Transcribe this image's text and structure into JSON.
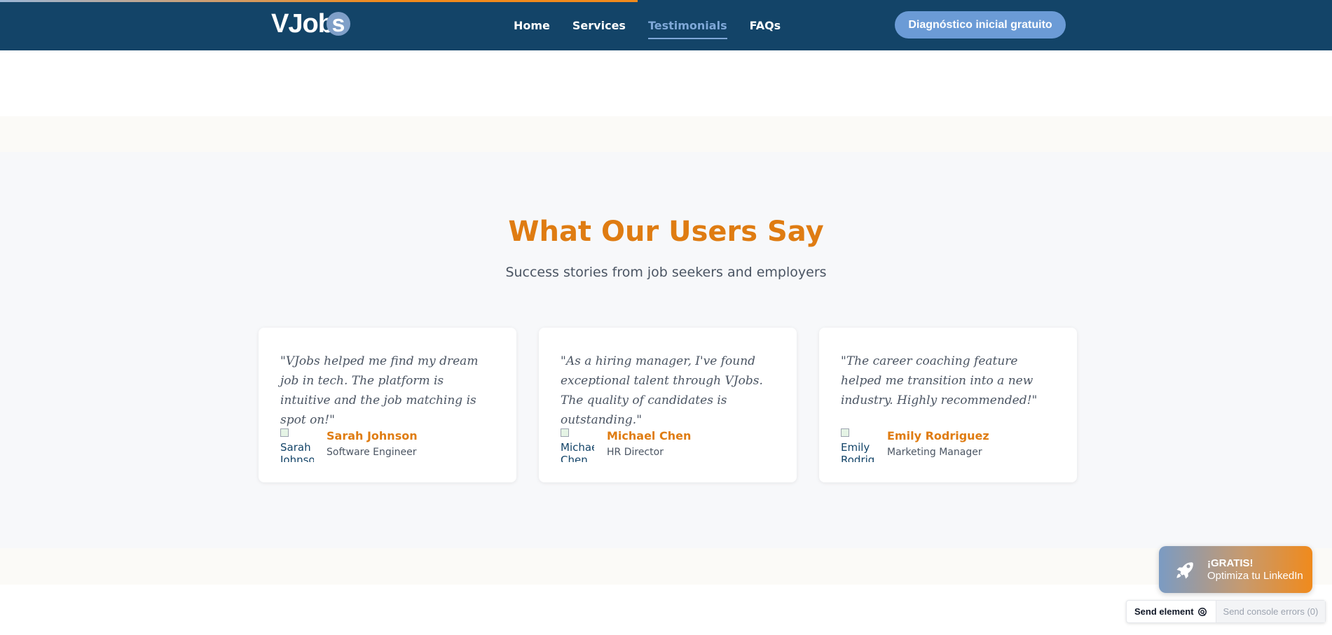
{
  "header": {
    "logo_text": "VJob",
    "logo_circle": "s",
    "nav": [
      {
        "label": "Home",
        "active": false
      },
      {
        "label": "Services",
        "active": false
      },
      {
        "label": "Testimonials",
        "active": true
      },
      {
        "label": "FAQs",
        "active": false
      }
    ],
    "cta_label": "Diagnóstico inicial gratuito"
  },
  "testimonials": {
    "title": "What Our Users Say",
    "subtitle": "Success stories from job seekers and employers",
    "cards": [
      {
        "quote": "\"VJobs helped me find my dream job in tech. The platform is intuitive and the job matching is spot on!\"",
        "avatar_alt": "Sarah Johnson",
        "name": "Sarah Johnson",
        "role": "Software Engineer"
      },
      {
        "quote": "\"As a hiring manager, I've found exceptional talent through VJobs. The quality of candidates is outstanding.\"",
        "avatar_alt": "Michael Chen",
        "name": "Michael Chen",
        "role": "HR Director"
      },
      {
        "quote": "\"The career coaching feature helped me transition into a new industry. Highly recommended!\"",
        "avatar_alt": "Emily Rodriguez",
        "name": "Emily Rodriguez",
        "role": "Marketing Manager"
      }
    ]
  },
  "promo": {
    "line1": "¡GRATIS!",
    "line2": "Optimiza tu LinkedIn",
    "icon": "rocket-icon"
  },
  "devbar": {
    "send_element": "Send element",
    "send_errors": "Send console errors (0)"
  },
  "colors": {
    "header_bg": "#134468",
    "accent_orange": "#df7c12",
    "cta_blue": "#6b9bd6",
    "nav_active": "#7fa8d8"
  }
}
